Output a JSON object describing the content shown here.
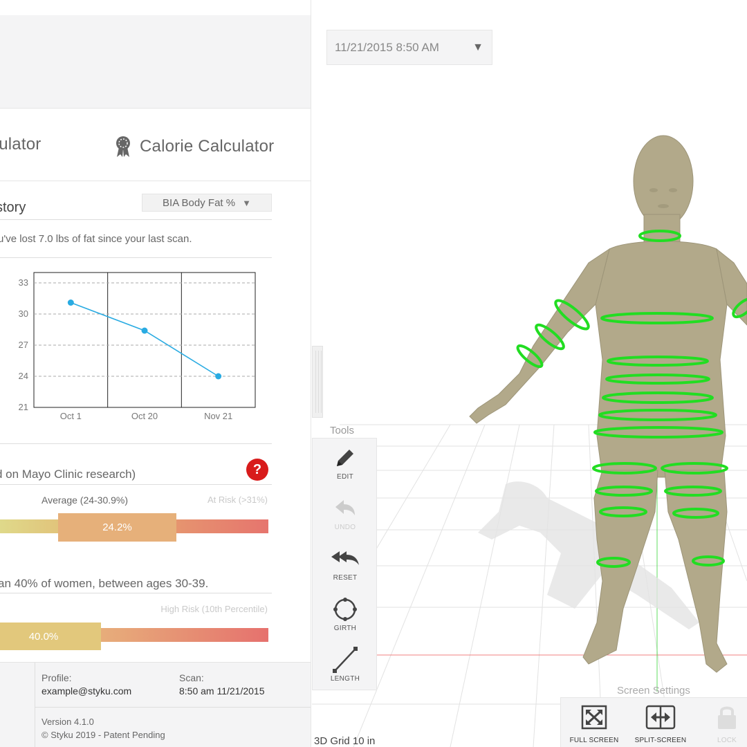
{
  "calculators": {
    "body_fat_tab": "culator",
    "calorie_tab": "Calorie Calculator"
  },
  "history": {
    "title": "story",
    "metric_selected": "BIA Body Fat %",
    "message": "u've lost 7.0 lbs of fat since your last scan."
  },
  "chart_data": {
    "type": "line",
    "categories": [
      "Oct 1",
      "Oct 20",
      "Nov 21"
    ],
    "series": [
      {
        "values": [
          31.1,
          28.4,
          24.0
        ]
      }
    ],
    "y_ticks": [
      33,
      30,
      27,
      24,
      21
    ],
    "ylim": [
      21,
      34
    ],
    "grid": "horizontal-dashed",
    "colors": {
      "line": "#29abe2"
    }
  },
  "mayo": {
    "text": "d on Mayo Clinic research)",
    "help_icon": "question-icon",
    "average_label": "Average (24-30.9%)",
    "at_risk_label": "At Risk (>31%)",
    "value_label": "24.2%",
    "value": 24.2
  },
  "percentile": {
    "text": "an 40% of women, between ages 30-39.",
    "risk_label": "High Risk (10th Percentile)",
    "value_label": "40.0%",
    "value": 40.0
  },
  "footer": {
    "profile_label": "Profile:",
    "profile_value": "example@styku.com",
    "scan_label": "Scan:",
    "scan_value": "8:50 am 11/21/2015",
    "version": "Version 4.1.0",
    "copyright": "© Styku 2019 - Patent Pending"
  },
  "viewport": {
    "scan_date": "11/21/2015 8:50 AM",
    "tools_title": "Tools",
    "tools": [
      {
        "label": "EDIT",
        "icon": "pencil-icon",
        "enabled": true
      },
      {
        "label": "UNDO",
        "icon": "undo-icon",
        "enabled": false
      },
      {
        "label": "RESET",
        "icon": "reset-icon",
        "enabled": true
      },
      {
        "label": "GIRTH",
        "icon": "girth-icon",
        "enabled": true
      },
      {
        "label": "LENGTH",
        "icon": "length-icon",
        "enabled": true
      }
    ],
    "grid_label": "3D Grid 10 in",
    "screen_settings_title": "Screen Settings",
    "screen_settings": [
      {
        "label": "FULL SCREEN",
        "icon": "fullscreen-icon",
        "enabled": true
      },
      {
        "label": "SPLIT-SCREEN",
        "icon": "split-screen-icon",
        "enabled": true
      },
      {
        "label": "LOCK",
        "icon": "lock-icon",
        "enabled": false
      }
    ],
    "colors": {
      "girth_ring": "#22dd22",
      "model": "#b2a98a"
    }
  }
}
